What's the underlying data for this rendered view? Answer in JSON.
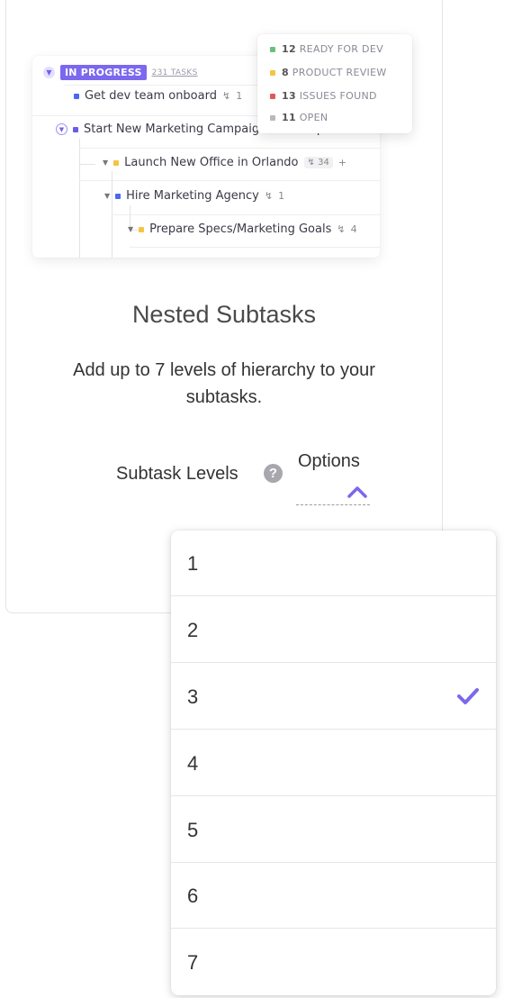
{
  "illustration": {
    "status_label": "IN PROGRESS",
    "task_count": "231 TASKS",
    "tasks": [
      {
        "name": "Get dev team onboard",
        "subtasks": "1"
      },
      {
        "name": "Start New Marketing Campaign for Europe",
        "subtasks": "4"
      },
      {
        "name": "Launch New Office in Orlando",
        "subtasks": "34",
        "plus": "+"
      },
      {
        "name": "Hire Marketing Agency",
        "subtasks": "1"
      },
      {
        "name": "Prepare Specs/Marketing Goals",
        "subtasks": "4"
      }
    ],
    "status_popup": [
      {
        "count": "12",
        "label": "READY FOR DEV",
        "color": "#6cc07a"
      },
      {
        "count": "8",
        "label": "PRODUCT REVIEW",
        "color": "#f4c542"
      },
      {
        "count": "13",
        "label": "ISSUES FOUND",
        "color": "#e05a5a"
      },
      {
        "count": "11",
        "label": "OPEN",
        "color": "#b8b8c0"
      }
    ]
  },
  "feature": {
    "title": "Nested Subtasks",
    "description": "Add up to 7 levels of hierarchy to your subtasks."
  },
  "setting": {
    "label": "Subtask Levels",
    "help_icon": "?",
    "select_label": "Options",
    "chevron_icon": "chevron-up-icon"
  },
  "dropdown": {
    "options": [
      "1",
      "2",
      "3",
      "4",
      "5",
      "6",
      "7"
    ],
    "selected": "3",
    "accent_color": "#7b68ee"
  }
}
